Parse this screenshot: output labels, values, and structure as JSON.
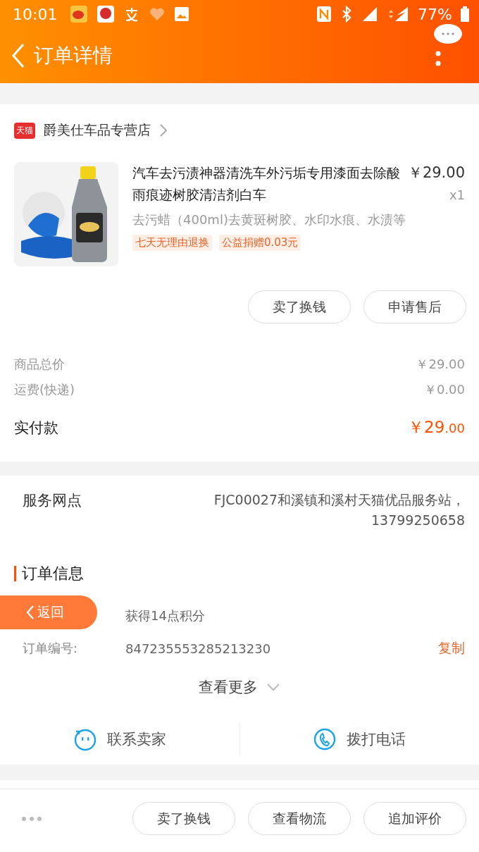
{
  "status_bar": {
    "time": "10:01",
    "battery": "77%"
  },
  "header": {
    "title": "订单详情"
  },
  "shop": {
    "badge": "天猫",
    "name": "爵美仕车品专营店"
  },
  "product": {
    "kind": "picture",
    "title": "汽车去污渍神器清洗车外污垢专用漆面去除酸雨痕迹树胶清洁剂白车",
    "price": "￥29.00",
    "quantity": "x1",
    "sku": "去污蜡（400ml)去黄斑树胶、水印水痕、水渍等",
    "tags": [
      "七天无理由退换",
      "公益捐赠0.03元"
    ]
  },
  "product_actions": [
    "卖了换钱",
    "申请售后"
  ],
  "totals": [
    {
      "label": "商品总价",
      "value": "￥29.00"
    },
    {
      "label": "运费(快递)",
      "value": "￥0.00"
    }
  ],
  "paid": {
    "label": "实付款",
    "value_main": "￥29",
    "value_decimal": ".00"
  },
  "service": {
    "label": "服务网点",
    "value": "FJC00027和溪镇和溪村天猫优品服务站，13799250658"
  },
  "order_info": {
    "title": "订单信息",
    "rows": [
      {
        "value": "获得14点积分"
      },
      {
        "label": "订单编号:",
        "value": "847235553285213230",
        "action": "复制"
      }
    ],
    "more": "查看更多"
  },
  "contact": [
    {
      "kind": "chat",
      "label": "联系卖家"
    },
    {
      "kind": "phone",
      "label": "拨打电话"
    }
  ],
  "bottom_buttons": [
    "卖了换钱",
    "查看物流",
    "追加评价"
  ],
  "float_back": {
    "label": "返回"
  }
}
